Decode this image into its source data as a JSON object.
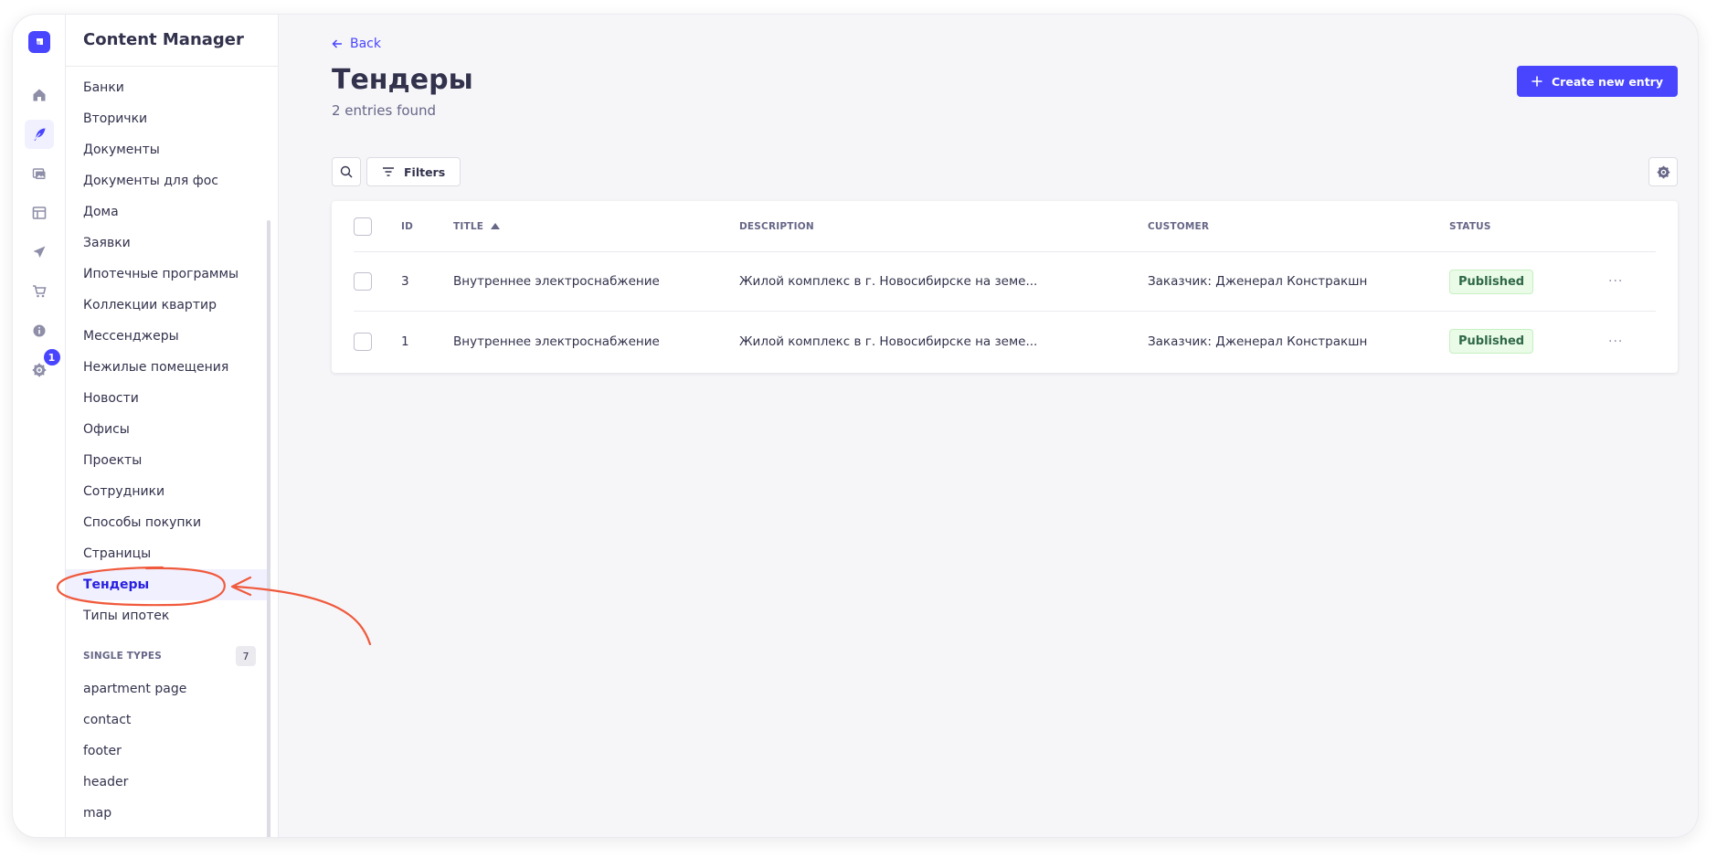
{
  "app": {
    "title": "Content Manager",
    "notification_count": "1"
  },
  "rail": {
    "icons": [
      "home-icon",
      "feather-icon",
      "media-icon",
      "layout-icon",
      "send-icon",
      "cart-icon",
      "info-icon",
      "gear-icon"
    ]
  },
  "sidebar": {
    "collection_items": [
      "Банки",
      "Вторички",
      "Документы",
      "Документы для фос",
      "Дома",
      "Заявки",
      "Ипотечные программы",
      "Коллекции квартир",
      "Мессенджеры",
      "Нежилые помещения",
      "Новости",
      "Офисы",
      "Проекты",
      "Сотрудники",
      "Способы покупки",
      "Страницы",
      "Тендеры",
      "Типы ипотек"
    ],
    "active_item": "Тендеры",
    "single_types": {
      "label": "SINGLE TYPES",
      "count": "7",
      "items": [
        "apartment page",
        "contact",
        "footer",
        "header",
        "map"
      ]
    }
  },
  "main": {
    "back_label": "Back",
    "title": "Тендеры",
    "subtitle": "2 entries found",
    "create_label": "Create new entry",
    "filters_label": "Filters",
    "table": {
      "headers": {
        "id": "ID",
        "title": "TITLE",
        "description": "DESCRIPTION",
        "customer": "CUSTOMER",
        "status": "STATUS"
      },
      "sort": {
        "column": "title",
        "direction": "asc"
      },
      "rows": [
        {
          "id": "3",
          "title": "Внутреннее электроснабжение",
          "description": "Жилой комплекс в г. Новосибирске на земе...",
          "customer": "Заказчик: Дженерал Констракшн",
          "status": "Published",
          "actions": "···"
        },
        {
          "id": "1",
          "title": "Внутреннее электроснабжение",
          "description": "Жилой комплекс в г. Новосибирске на земе...",
          "customer": "Заказчик: Дженерал Констракшн",
          "status": "Published",
          "actions": "···"
        }
      ]
    }
  },
  "colors": {
    "accent": "#4945ff",
    "annotation": "#f05a3c",
    "published": "#2f6846"
  }
}
